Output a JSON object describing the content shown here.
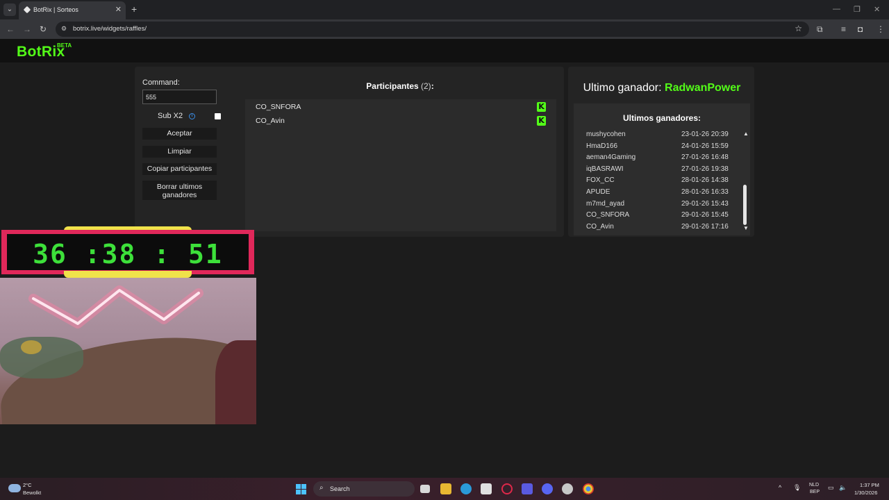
{
  "browser": {
    "tab_menu_icon": "chevron-down-icon",
    "tab_title": "BotRix | Sorteos",
    "tab_close": "✕",
    "new_tab": "+",
    "window_controls": [
      "—",
      "❐",
      "✕"
    ],
    "nav": {
      "back": "←",
      "forward": "→",
      "reload": "↻"
    },
    "url": "botrix.live/widgets/raffles/",
    "site_info_icon": "tune-icon",
    "bookmark_icon": "☆"
  },
  "app": {
    "logo": "BotRix",
    "logo_badge": "BETA",
    "brand_color": "#53fc18"
  },
  "controls": {
    "command_label": "Command:",
    "command_value": "555",
    "sub_label": "Sub X2",
    "sub_info_icon": "i",
    "sub_checked": false,
    "buttons": [
      "Aceptar",
      "Limpiar",
      "Copiar participantes",
      "Borrar ultimos ganadores"
    ]
  },
  "participants": {
    "title": "Participantes",
    "count": "(2)",
    "suffix": ":",
    "list": [
      {
        "name": "CO_SNFORA",
        "platform_icon": "K"
      },
      {
        "name": "CO_Avin",
        "platform_icon": "K"
      }
    ]
  },
  "winner": {
    "label": "Ultimo ganador: ",
    "name": "RadwanPower",
    "recent_title": "Ultimos ganadores:",
    "recent": [
      {
        "name": "mushycohen",
        "date": "23-01-26 20:39"
      },
      {
        "name": "HmaD166",
        "date": "24-01-26 15:59"
      },
      {
        "name": "aeman4Gaming",
        "date": "27-01-26 16:48"
      },
      {
        "name": "iqBASRAWI",
        "date": "27-01-26 19:38"
      },
      {
        "name": "FOX_CC",
        "date": "28-01-26 14:38"
      },
      {
        "name": "APUDE",
        "date": "28-01-26 16:33"
      },
      {
        "name": "m7md_ayad",
        "date": "29-01-26 15:43"
      },
      {
        "name": "CO_SNFORA",
        "date": "29-01-26 15:45"
      },
      {
        "name": "CO_Avin",
        "date": "29-01-26 17:16"
      }
    ],
    "scroll_up": "▲",
    "scroll_down": "▼"
  },
  "timer": {
    "value": "36 :38 : 51",
    "text_color": "#3de03a",
    "frame_color": "#e0285a"
  },
  "taskbar": {
    "weather_temp": "2°C",
    "weather_cond": "Bewolkt",
    "search_label": "Search",
    "lang_top": "NLD",
    "lang_bottom": "BEP",
    "time": "1:37 PM",
    "date": "1/30/2026"
  }
}
